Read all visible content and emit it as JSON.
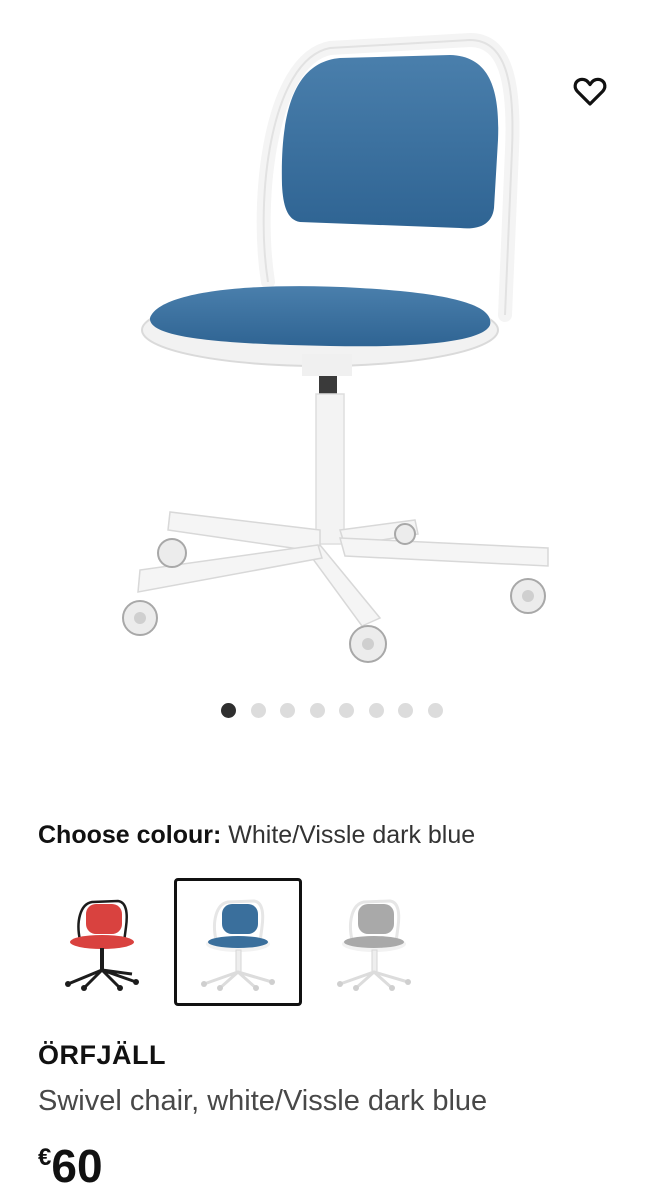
{
  "gallery": {
    "image_icon": "chair-photo",
    "dot_count": 8,
    "active_dot": 1,
    "favourite_icon": "heart-outline-icon"
  },
  "colour": {
    "label": "Choose colour:",
    "selected": "White/Vissle dark blue",
    "options": [
      {
        "name": "red-black",
        "seat": "#d9423f",
        "frame": "#1c1c1c"
      },
      {
        "name": "white-blue",
        "seat": "#3a6f9c",
        "frame": "#ffffff"
      },
      {
        "name": "white-grey",
        "seat": "#a9a9a9",
        "frame": "#ffffff"
      }
    ],
    "selected_index": 1
  },
  "product": {
    "name": "ÖRFJÄLL",
    "description": "Swivel chair, white/Vissle dark blue",
    "price_currency": "€",
    "price_amount": "60"
  },
  "colors": {
    "seat_blue": "#3a6d9b",
    "frame_white": "#ffffff",
    "text": "#111111"
  }
}
